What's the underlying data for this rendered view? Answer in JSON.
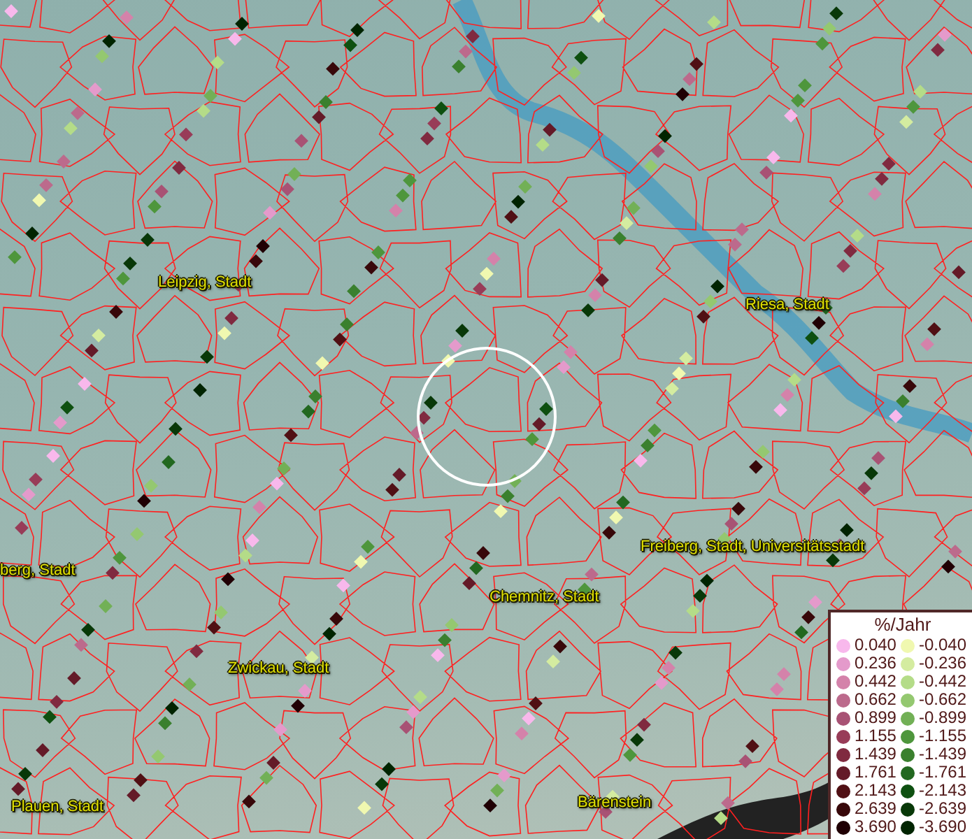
{
  "map": {
    "place_labels": [
      {
        "text": "Leipzig, Stadt"
      },
      {
        "text": "Riesa, Stadt"
      },
      {
        "text": "berg, Stadt"
      },
      {
        "text": "Freiberg, Stadt, Universitätsstadt"
      },
      {
        "text": "Chemnitz, Stadt"
      },
      {
        "text": "Zwickau, Stadt"
      },
      {
        "text": "Plauen, Stadt"
      },
      {
        "text": "Bärenstein"
      }
    ]
  },
  "legend": {
    "title": "%/Jahr",
    "items": [
      {
        "label": "0.040",
        "color": "#f8b8ec"
      },
      {
        "label": "-0.040",
        "color": "#f0f8b0"
      },
      {
        "label": "0.236",
        "color": "#e49acb"
      },
      {
        "label": "-0.236",
        "color": "#d4eca0"
      },
      {
        "label": "0.442",
        "color": "#d482aa"
      },
      {
        "label": "-0.442",
        "color": "#b4dc88"
      },
      {
        "label": "0.662",
        "color": "#bc6a8c"
      },
      {
        "label": "-0.662",
        "color": "#94c870"
      },
      {
        "label": "0.899",
        "color": "#a85274"
      },
      {
        "label": "-0.899",
        "color": "#72b056"
      },
      {
        "label": "1.155",
        "color": "#983c58"
      },
      {
        "label": "-1.155",
        "color": "#4e963c"
      },
      {
        "label": "1.439",
        "color": "#802a40"
      },
      {
        "label": "-1.439",
        "color": "#3a802e"
      },
      {
        "label": "1.761",
        "color": "#641a28"
      },
      {
        "label": "-1.761",
        "color": "#226820"
      },
      {
        "label": "2.143",
        "color": "#501014"
      },
      {
        "label": "-2.143",
        "color": "#0e5010"
      },
      {
        "label": "2.639",
        "color": "#38080a"
      },
      {
        "label": "-2.639",
        "color": "#083808"
      },
      {
        "label": "3.690",
        "color": "#200004"
      },
      {
        "label": "-3.690",
        "color": "#002400"
      }
    ]
  }
}
